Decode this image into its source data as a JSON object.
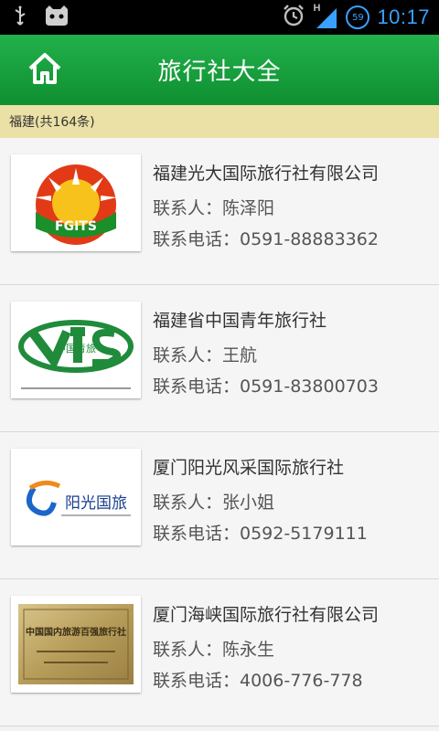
{
  "status_bar": {
    "time": "10:17",
    "network": "H",
    "battery": "59",
    "icons": [
      "usb-icon",
      "android-debug-icon",
      "alarm-icon",
      "signal-icon",
      "battery-icon"
    ]
  },
  "app_bar": {
    "title": "旅行社大全",
    "home_icon": "home-icon"
  },
  "filter": {
    "label": "福建(共164条)"
  },
  "agencies": [
    {
      "name": "福建光大国际旅行社有限公司",
      "contact": "联系人：陈泽阳",
      "phone": "联系电话：0591-88883362",
      "logo_text": "FGITS"
    },
    {
      "name": "福建省中国青年旅行社",
      "contact": "联系人：王航",
      "phone": "联系电话：0591-83800703",
      "logo_text": "中国青旅"
    },
    {
      "name": "厦门阳光风采国际旅行社",
      "contact": "联系人：张小姐",
      "phone": "联系电话：0592-5179111",
      "logo_text": "阳光国旅"
    },
    {
      "name": "厦门海峡国际旅行社有限公司",
      "contact": "联系人：陈永生",
      "phone": "联系电话：4006-776-778",
      "logo_text": "中国国内旅游百强旅行社"
    }
  ],
  "colors": {
    "app_bar": "#1aa43f",
    "filter_bar": "#ebe0a5",
    "status_accent": "#3aa0ff"
  }
}
